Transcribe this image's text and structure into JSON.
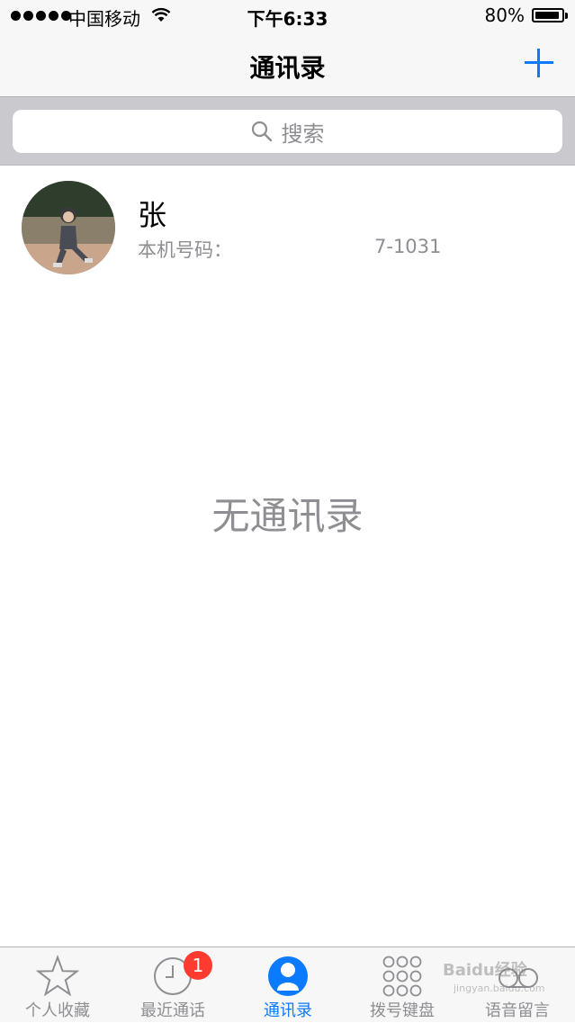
{
  "status": {
    "carrier": "中国移动",
    "time": "下午6:33",
    "battery": "80%"
  },
  "nav": {
    "title": "通讯录",
    "add_icon": "plus-icon"
  },
  "search": {
    "placeholder": "搜索"
  },
  "contact": {
    "name": "张",
    "subtitle": "本机号码：",
    "phone_tail": "7-1031"
  },
  "main": {
    "empty_text": "无通讯录"
  },
  "tabs": [
    {
      "label": "个人收藏",
      "icon": "star-icon"
    },
    {
      "label": "最近通话",
      "icon": "clock-icon",
      "badge": "1"
    },
    {
      "label": "通讯录",
      "icon": "contacts-icon",
      "active": true
    },
    {
      "label": "拨号键盘",
      "icon": "keypad-icon"
    },
    {
      "label": "语音留言",
      "icon": "voicemail-icon"
    }
  ],
  "colors": {
    "accent": "#0a7aff",
    "badge": "#ff3b30",
    "secondary_text": "#8e8e93"
  },
  "watermark": {
    "text": "Baidu经验",
    "sub": "jingyan.baidu.com"
  }
}
